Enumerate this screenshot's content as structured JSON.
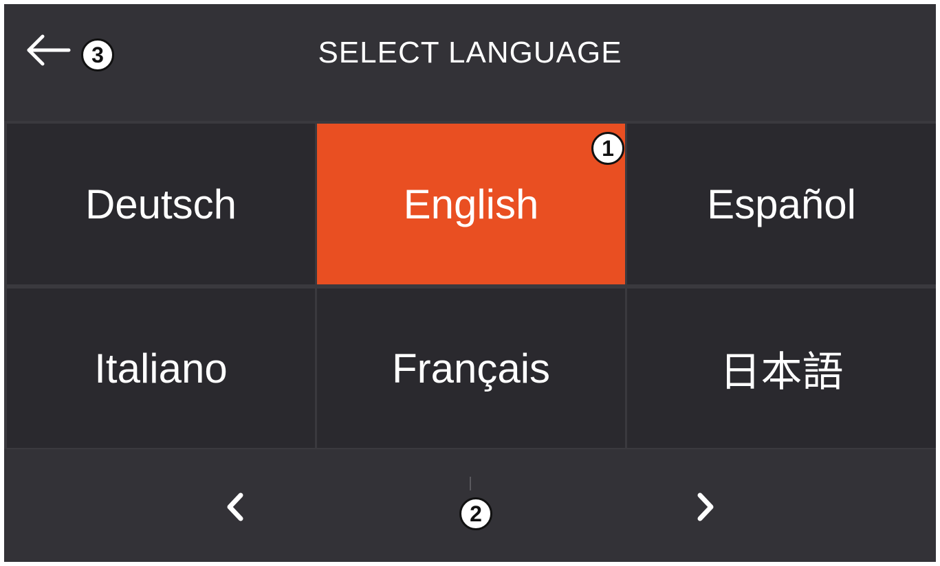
{
  "header": {
    "title": "SELECT LANGUAGE",
    "back_icon": "arrow-left-icon"
  },
  "languages": [
    {
      "label": "Deutsch",
      "selected": false
    },
    {
      "label": "English",
      "selected": true
    },
    {
      "label": "Español",
      "selected": false
    },
    {
      "label": "Italiano",
      "selected": false
    },
    {
      "label": "Français",
      "selected": false
    },
    {
      "label": "日本語",
      "selected": false
    }
  ],
  "pager": {
    "prev_icon": "chevron-left-icon",
    "next_icon": "chevron-right-icon"
  },
  "callouts": [
    "1",
    "2",
    "3"
  ],
  "colors": {
    "background": "#323136",
    "cell": "#2a292e",
    "selected": "#e94f22",
    "text": "#ffffff"
  }
}
